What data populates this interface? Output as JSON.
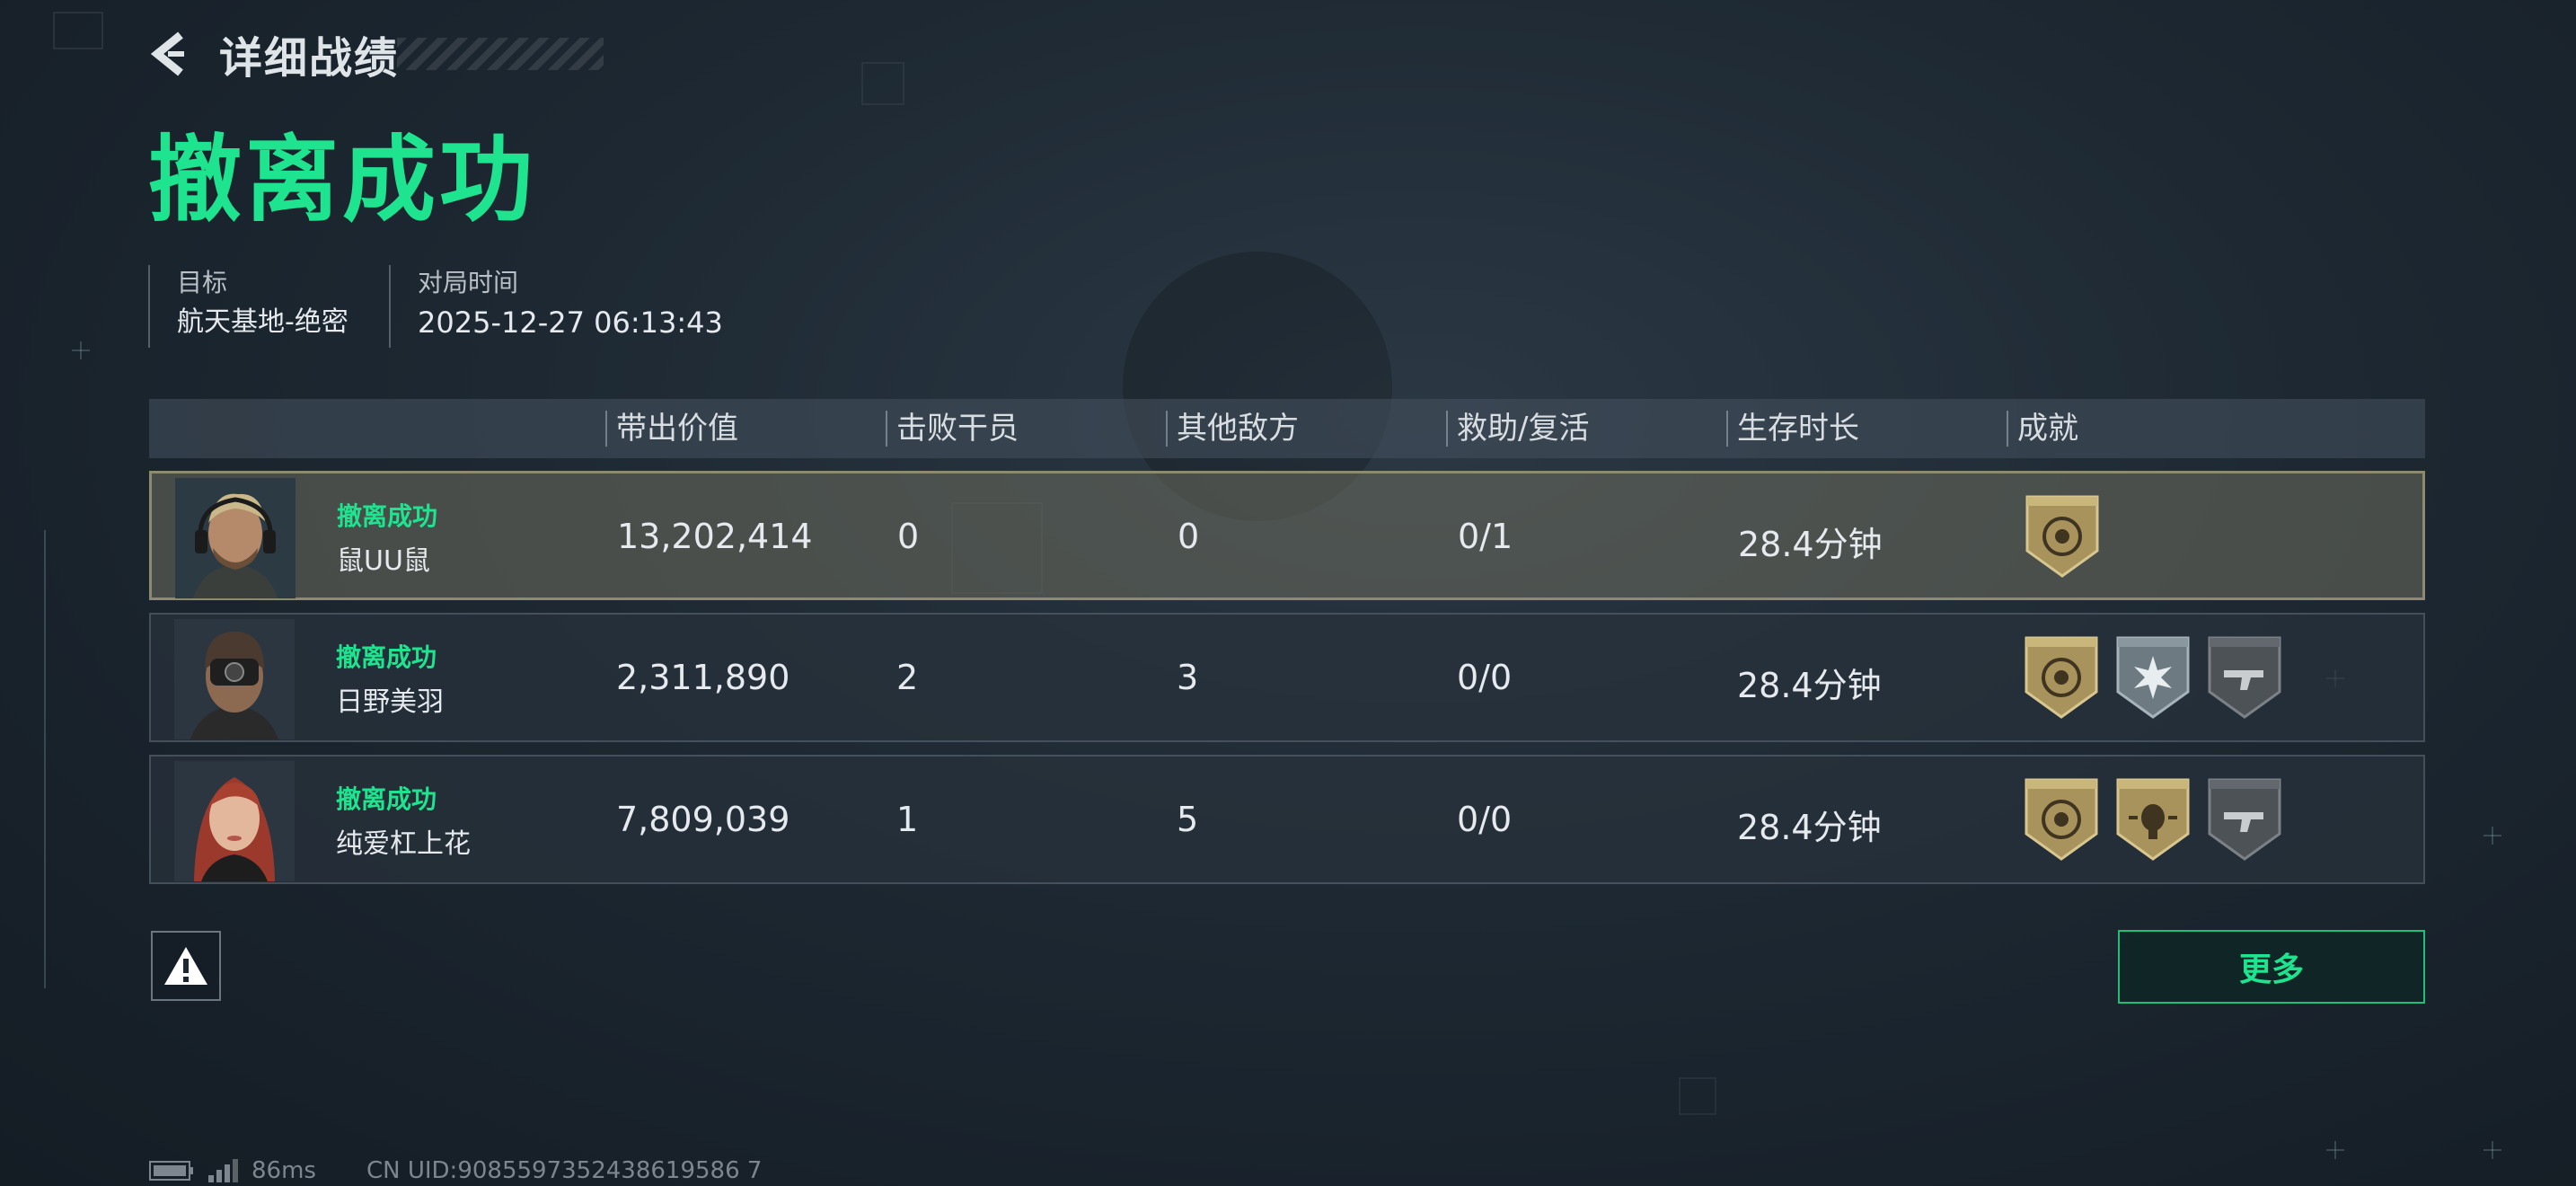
{
  "header": {
    "title": "详细战绩"
  },
  "result": {
    "title": "撤离成功"
  },
  "info": {
    "target_label": "目标",
    "target_value": "航天基地-绝密",
    "time_label": "对局时间",
    "time_value": "2025-12-27 06:13:43"
  },
  "table": {
    "columns": [
      "带出价值",
      "击败干员",
      "其他敌方",
      "救助/复活",
      "生存时长",
      "成就"
    ],
    "rows": [
      {
        "status": "撤离成功",
        "name": "鼠UU鼠",
        "value": "13,202,414",
        "kills": "0",
        "other": "0",
        "assist": "0/1",
        "time": "28.4分钟",
        "badges": [
          "gold-emblem-badge"
        ]
      },
      {
        "status": "撤离成功",
        "name": "日野美羽",
        "value": "2,311,890",
        "kills": "2",
        "other": "3",
        "assist": "0/0",
        "time": "28.4分钟",
        "badges": [
          "gold-emblem-badge",
          "silver-burst-badge",
          "gray-gun-badge"
        ]
      },
      {
        "status": "撤离成功",
        "name": "纯爱杠上花",
        "value": "7,809,039",
        "kills": "1",
        "other": "5",
        "assist": "0/0",
        "time": "28.4分钟",
        "badges": [
          "gold-emblem-badge",
          "gold-skull-badge",
          "gray-gun-badge"
        ]
      }
    ]
  },
  "buttons": {
    "more": "更多",
    "report_icon": "warning-icon"
  },
  "footer": {
    "ping": "86ms",
    "uid": "CN UID:9085597352438619586 7"
  },
  "colors": {
    "accent": "#1ee38f",
    "background": "#1d2832",
    "gold": "#b7a36a"
  }
}
